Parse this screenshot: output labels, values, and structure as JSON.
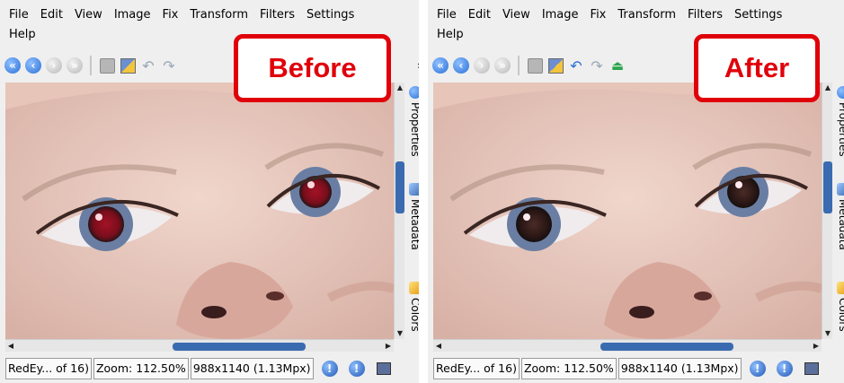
{
  "panels": [
    {
      "badge": "Before",
      "menu": [
        "File",
        "Edit",
        "View",
        "Image",
        "Fix",
        "Transform",
        "Filters",
        "Settings"
      ],
      "menu_row2": [
        "Help"
      ],
      "sidetabs": [
        "Properties",
        "Metadata",
        "Colors"
      ],
      "status": {
        "file": "RedEy... of 16)",
        "zoom": "Zoom: 112.50%",
        "size": "988x1140 (1.13Mpx)"
      },
      "eye_color": "#a41226",
      "toolbar_more": "»"
    },
    {
      "badge": "After",
      "menu": [
        "File",
        "Edit",
        "View",
        "Image",
        "Fix",
        "Transform",
        "Filters",
        "Settings"
      ],
      "menu_row2": [
        "Help"
      ],
      "sidetabs": [
        "Properties",
        "Metadata",
        "Colors"
      ],
      "status": {
        "file": "RedEy... of 16)",
        "zoom": "Zoom: 112.50%",
        "size": "988x1140 (1.13Mpx)"
      },
      "eye_color": "#3a2320",
      "toolbar_more": "»"
    }
  ],
  "colors": {
    "accent_red": "#e0000a",
    "scroll_thumb": "#3a6bb0"
  }
}
